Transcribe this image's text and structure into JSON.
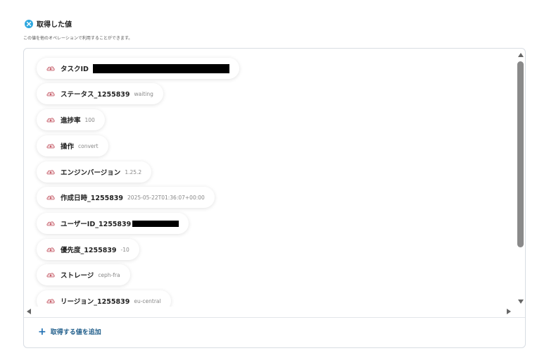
{
  "section": {
    "title": "取得した値",
    "subtitle": "この値を他のオペレーションで利用することができます。"
  },
  "items": [
    {
      "label": "タスクID",
      "value": "",
      "redacted": true
    },
    {
      "label": "ステータス_1255839",
      "value": "waiting"
    },
    {
      "label": "進捗率",
      "value": "100"
    },
    {
      "label": "操作",
      "value": "convert"
    },
    {
      "label": "エンジンバージョン",
      "value": "1.25.2"
    },
    {
      "label": "作成日時_1255839",
      "value": "2025-05-22T01:36:07+00:00"
    },
    {
      "label": "ユーザーID_1255839",
      "value": "",
      "redacted": true
    },
    {
      "label": "優先度_1255839",
      "value": "-10"
    },
    {
      "label": "ストレージ",
      "value": "ceph-fra"
    },
    {
      "label": "リージョン_1255839",
      "value": "eu-central"
    }
  ],
  "add_button": {
    "icon": "plus-icon",
    "label": "取得する値を追加"
  },
  "colors": {
    "accent": "#2ea8e0",
    "link": "#1f5d8a",
    "redaction": "#000000"
  },
  "icons": {
    "header": "badge-icon",
    "item": "cloud-icon"
  }
}
